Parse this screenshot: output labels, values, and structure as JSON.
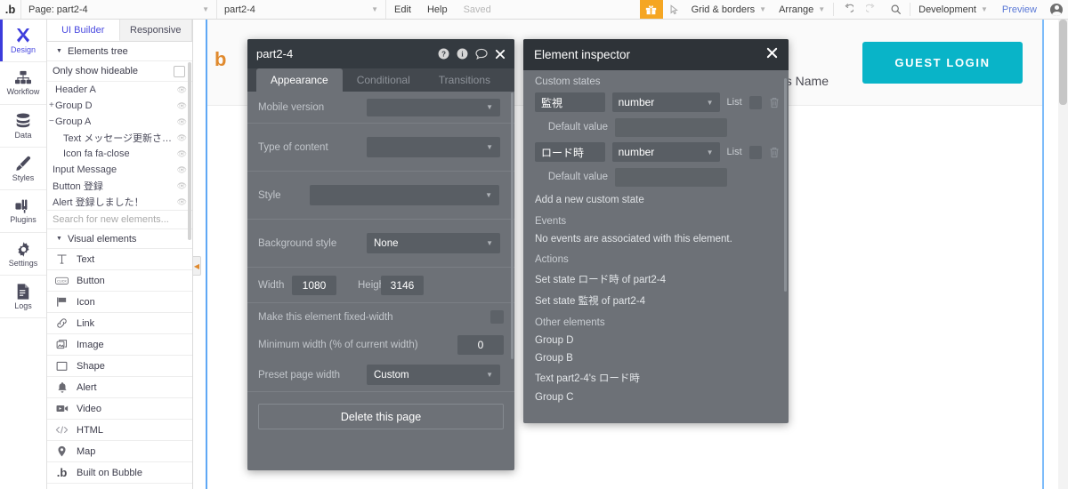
{
  "topbar": {
    "logo": ".b",
    "page_select": {
      "label": "Page: part2-4"
    },
    "element_select": {
      "label": "part2-4"
    },
    "edit": "Edit",
    "help": "Help",
    "saved": "Saved",
    "gift_icon": "gift-icon",
    "pointer_icon": "pointer-icon",
    "grid_borders": "Grid & borders",
    "arrange": "Arrange",
    "undo_icon": "undo-icon",
    "redo_icon": "redo-icon",
    "search_icon": "search-icon",
    "version": "Development",
    "preview": "Preview",
    "avatar": "user-avatar"
  },
  "rail": {
    "items": [
      {
        "label": "Design",
        "icon": "design-icon",
        "active": true
      },
      {
        "label": "Workflow",
        "icon": "workflow-icon",
        "active": false
      },
      {
        "label": "Data",
        "icon": "data-icon",
        "active": false
      },
      {
        "label": "Styles",
        "icon": "styles-icon",
        "active": false
      },
      {
        "label": "Plugins",
        "icon": "plugins-icon",
        "active": false
      },
      {
        "label": "Settings",
        "icon": "settings-icon",
        "active": false
      },
      {
        "label": "Logs",
        "icon": "logs-icon",
        "active": false
      }
    ]
  },
  "left_panel": {
    "tabs": [
      {
        "label": "UI Builder",
        "active": true
      },
      {
        "label": "Responsive",
        "active": false
      }
    ],
    "elements_tree_title": "Elements tree",
    "only_show_hideable": "Only show hideable",
    "tree": [
      {
        "expander": "",
        "label": "Header A",
        "indent": false
      },
      {
        "expander": "+",
        "label": "Group D",
        "indent": false
      },
      {
        "expander": "−",
        "label": "Group A",
        "indent": false
      },
      {
        "expander": "",
        "label": "Text メッセージ更新され…",
        "indent": true
      },
      {
        "expander": "",
        "label": "Icon fa fa-close",
        "indent": true
      },
      {
        "expander": "",
        "label": "Input Message",
        "indent": false
      },
      {
        "expander": "",
        "label": "Button 登録",
        "indent": false
      },
      {
        "expander": "",
        "label": "Alert 登録しました！",
        "indent": false
      }
    ],
    "search_placeholder": "Search for new elements...",
    "visual_elements_title": "Visual elements",
    "visual_elements": [
      {
        "label": "Text",
        "icon": "text-icon"
      },
      {
        "label": "Button",
        "icon": "button-icon"
      },
      {
        "label": "Icon",
        "icon": "flag-icon"
      },
      {
        "label": "Link",
        "icon": "link-icon"
      },
      {
        "label": "Image",
        "icon": "image-icon"
      },
      {
        "label": "Shape",
        "icon": "shape-icon"
      },
      {
        "label": "Alert",
        "icon": "bell-icon"
      },
      {
        "label": "Video",
        "icon": "video-icon"
      },
      {
        "label": "HTML",
        "icon": "code-icon"
      },
      {
        "label": "Map",
        "icon": "map-pin-icon"
      },
      {
        "label": "Built on Bubble",
        "icon": "bubble-icon"
      }
    ]
  },
  "canvas": {
    "logo": "b",
    "username": "ser's Name",
    "guest_login": "GUEST LOGIN",
    "accent_color": "#09b4c8"
  },
  "property_editor": {
    "title": "part2-4",
    "header_icons": [
      "help-icon",
      "info-icon",
      "comment-icon",
      "close-icon"
    ],
    "tabs": [
      {
        "label": "Appearance",
        "active": true
      },
      {
        "label": "Conditional",
        "active": false
      },
      {
        "label": "Transitions",
        "active": false
      }
    ],
    "rows": {
      "mobile_version": "Mobile version",
      "type_of_content": "Type of content",
      "style": "Style",
      "background_style": "Background style",
      "background_style_value": "None",
      "width_label": "Width",
      "width_value": "1080",
      "height_label": "Height",
      "height_value": "3146",
      "fixed_width": "Make this element fixed-width",
      "minimum_width": "Minimum width (% of current width)",
      "minimum_width_value": "0",
      "preset_page_width": "Preset page width",
      "preset_page_width_value": "Custom"
    },
    "delete_button": "Delete this page"
  },
  "inspector": {
    "title": "Element inspector",
    "close_icon": "close-icon",
    "custom_states_label": "Custom states",
    "states": [
      {
        "name": "監視",
        "type": "number",
        "list_label": "List",
        "default_label": "Default value",
        "default_value": ""
      },
      {
        "name": "ロード時",
        "type": "number",
        "list_label": "List",
        "default_label": "Default value",
        "default_value": ""
      }
    ],
    "add_state": "Add a new custom state",
    "events_label": "Events",
    "events_empty": "No events are associated with this element.",
    "actions_label": "Actions",
    "actions": [
      "Set state ロード時 of part2-4",
      "Set state 監視 of part2-4"
    ],
    "other_elements_label": "Other elements",
    "other_elements": [
      "Group D",
      "Group B",
      "Text part2-4's ロード時",
      "Group C"
    ]
  }
}
